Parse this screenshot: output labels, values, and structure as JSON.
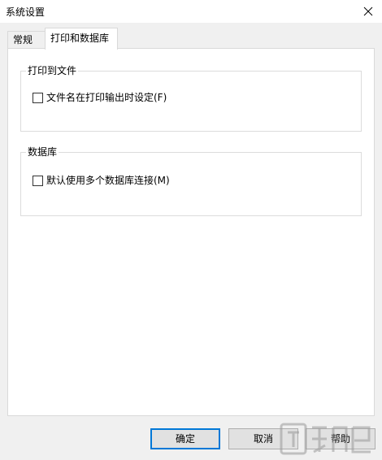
{
  "window": {
    "title": "系统设置"
  },
  "tabs": [
    {
      "label": "常规"
    },
    {
      "label": "打印和数据库"
    }
  ],
  "groups": {
    "print_to_file": {
      "title": "打印到文件",
      "checkbox_label": "文件名在打印输出时设定(F)",
      "checked": false
    },
    "database": {
      "title": "数据库",
      "checkbox_label": "默认使用多个数据库连接(M)",
      "checked": false
    }
  },
  "buttons": {
    "ok_label": "确定",
    "cancel_label": "取消",
    "help_label": "帮助"
  },
  "colors": {
    "accent": "#0078d7",
    "dialog_bg": "#f0f0f0",
    "panel_bg": "#ffffff"
  }
}
